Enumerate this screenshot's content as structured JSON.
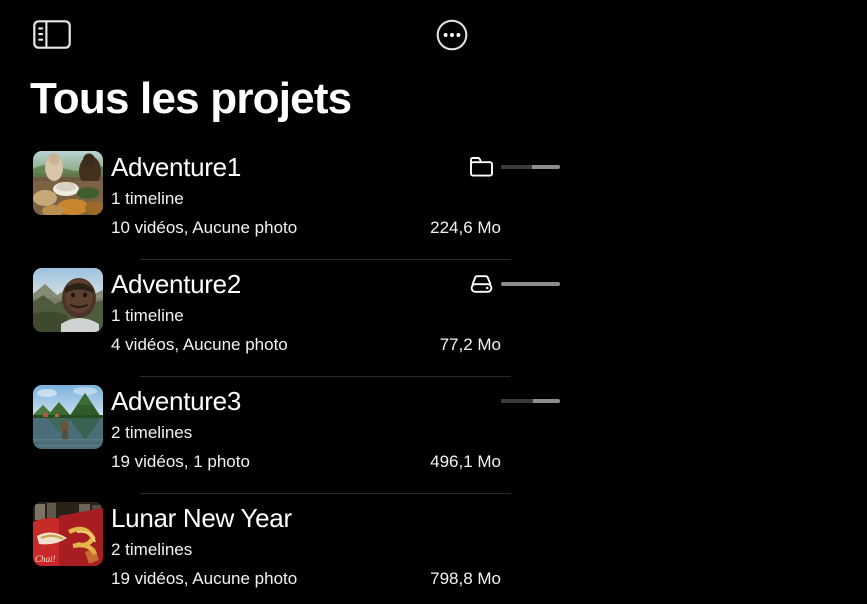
{
  "window": {
    "title": "Tous les projets",
    "background_color": "#000000",
    "text_color": "#ffffff"
  },
  "toolbar": {
    "sidebar_toggle": {
      "icon": "sidebar-toggle-icon",
      "label": "Afficher/Masquer la barre latérale"
    },
    "more": {
      "icon": "ellipsis-circle-icon",
      "label": "Plus d'options"
    }
  },
  "header": {
    "title": "Tous les projets"
  },
  "list": {
    "projects": [
      {
        "name": "Adventure1",
        "timelines": "1 timeline",
        "counts": "10 vidéos, Aucune photo",
        "size": "224,6 Mo",
        "location_icon": "folder-icon",
        "capacity_bar": {
          "visible": true,
          "fill_percent": 52
        },
        "thumbnail": "photo-meal-table"
      },
      {
        "name": "Adventure2",
        "timelines": "1 timeline",
        "counts": "4 vidéos, Aucune photo",
        "size": "77,2 Mo",
        "location_icon": "external-drive-icon",
        "capacity_bar": {
          "visible": true,
          "fill_percent": 0
        },
        "thumbnail": "photo-selfie-mountains"
      },
      {
        "name": "Adventure3",
        "timelines": "2 timelines",
        "counts": "19 vidéos, 1 photo",
        "size": "496,1 Mo",
        "location_icon": "none",
        "capacity_bar": {
          "visible": true,
          "fill_percent": 55
        },
        "thumbnail": "photo-karst-lake"
      },
      {
        "name": "Lunar New Year",
        "timelines": "2 timelines",
        "counts": "19 vidéos, Aucune photo",
        "size": "798,8 Mo",
        "location_icon": "none",
        "capacity_bar": {
          "visible": false,
          "fill_percent": 0
        },
        "thumbnail": "photo-lunar-new-year-red"
      }
    ]
  },
  "colors": {
    "background": "#000000",
    "primary_text": "#ffffff",
    "secondary_text": "#f2f2f2",
    "divider": "#2a2a2a",
    "bar_track": "#8d8d8d",
    "bar_fill": "#3b3b3b"
  }
}
